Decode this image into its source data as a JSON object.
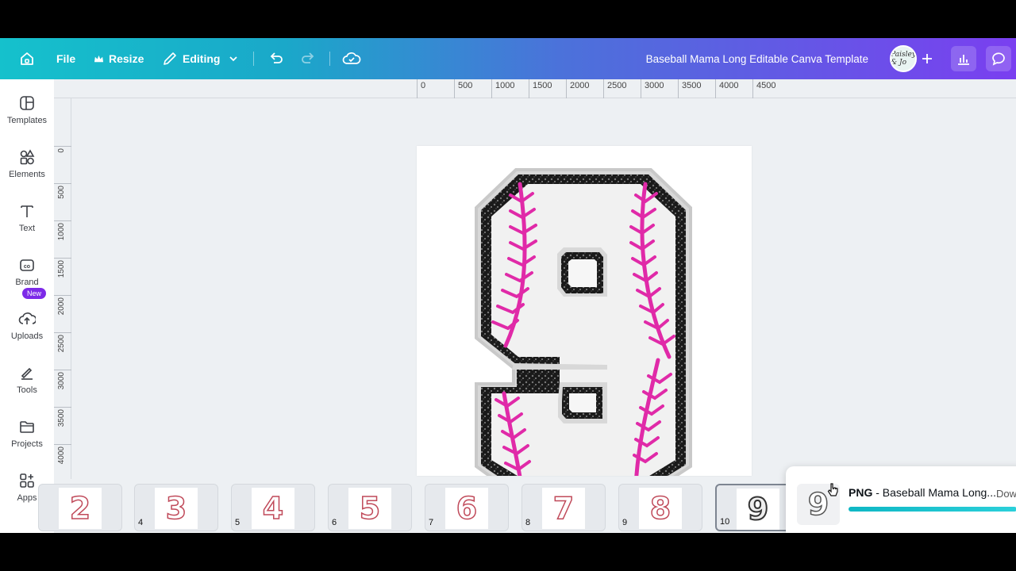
{
  "topbar": {
    "home_icon": "home-icon",
    "file_label": "File",
    "resize_label": "Resize",
    "editing_label": "Editing",
    "doc_title": "Baseball Mama Long Editable Canva Template",
    "avatar_text": "Paisley & Jo"
  },
  "sidebar": {
    "items": [
      {
        "label": "Templates",
        "icon": "templates-icon"
      },
      {
        "label": "Elements",
        "icon": "elements-icon"
      },
      {
        "label": "Text",
        "icon": "text-icon"
      },
      {
        "label": "Brand",
        "icon": "brand-icon"
      },
      {
        "label": "Uploads",
        "icon": "uploads-icon"
      },
      {
        "label": "Tools",
        "icon": "tools-icon"
      },
      {
        "label": "Projects",
        "icon": "projects-icon"
      },
      {
        "label": "Apps",
        "icon": "apps-icon"
      }
    ],
    "new_badge": "New"
  },
  "ruler": {
    "top_ticks": [
      "0",
      "500",
      "1000",
      "1500",
      "2000",
      "2500",
      "3000",
      "3500",
      "4000",
      "4500"
    ],
    "left_ticks": [
      "0",
      "500",
      "1000",
      "1500",
      "2000",
      "2500",
      "3000",
      "3500",
      "4000"
    ]
  },
  "canvas": {
    "digit": "9",
    "stitch_color": "#e02aa8"
  },
  "filmstrip": {
    "pages": [
      {
        "num": "",
        "digit": "2"
      },
      {
        "num": "4",
        "digit": "3"
      },
      {
        "num": "5",
        "digit": "4"
      },
      {
        "num": "6",
        "digit": "5"
      },
      {
        "num": "7",
        "digit": "6"
      },
      {
        "num": "8",
        "digit": "7"
      },
      {
        "num": "9",
        "digit": "8"
      },
      {
        "num": "10",
        "digit": "9"
      }
    ]
  },
  "toast": {
    "format": "PNG",
    "title": " - Baseball Mama Long...",
    "action": "Dow",
    "progress": 1.0
  }
}
